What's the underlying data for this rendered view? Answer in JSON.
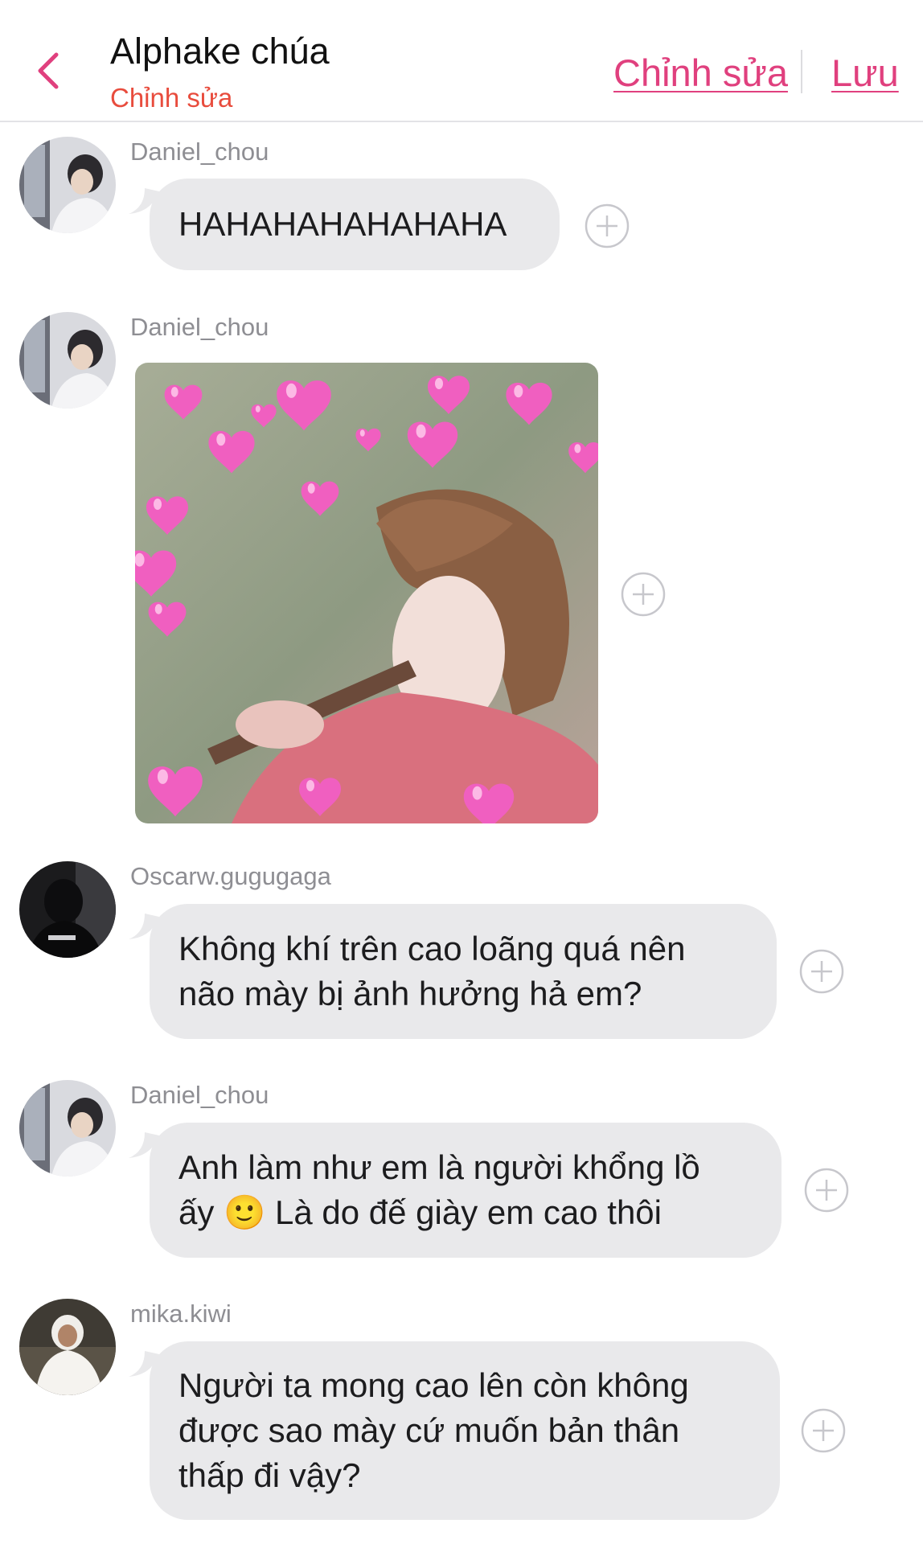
{
  "header": {
    "title": "Alphake chúa",
    "subtitle": "Chỉnh sửa",
    "edit_label": "Chỉnh sửa",
    "save_label": "Lưu",
    "accent": "#e0407e"
  },
  "messages": [
    {
      "user": "Daniel_chou",
      "text": "HAHAHAHAHAHAHA"
    },
    {
      "user": "Daniel_chou",
      "type": "image"
    },
    {
      "user": "Oscarw.gugugaga",
      "line1": "Không khí trên cao loãng quá nên",
      "line2": "não mày bị ảnh hưởng hả em?"
    },
    {
      "user": "Daniel_chou",
      "line1": "Anh làm như em là người khổng lồ",
      "line2_pre": "ấy ",
      "emoji": "🙂",
      "line2_post": " Là do đế giày em cao thôi"
    },
    {
      "user": "mika.kiwi",
      "line1": "Người ta mong cao lên còn không",
      "line2": "được sao mày cứ muốn bản thân",
      "line3": "thấp đi vậy?"
    }
  ]
}
